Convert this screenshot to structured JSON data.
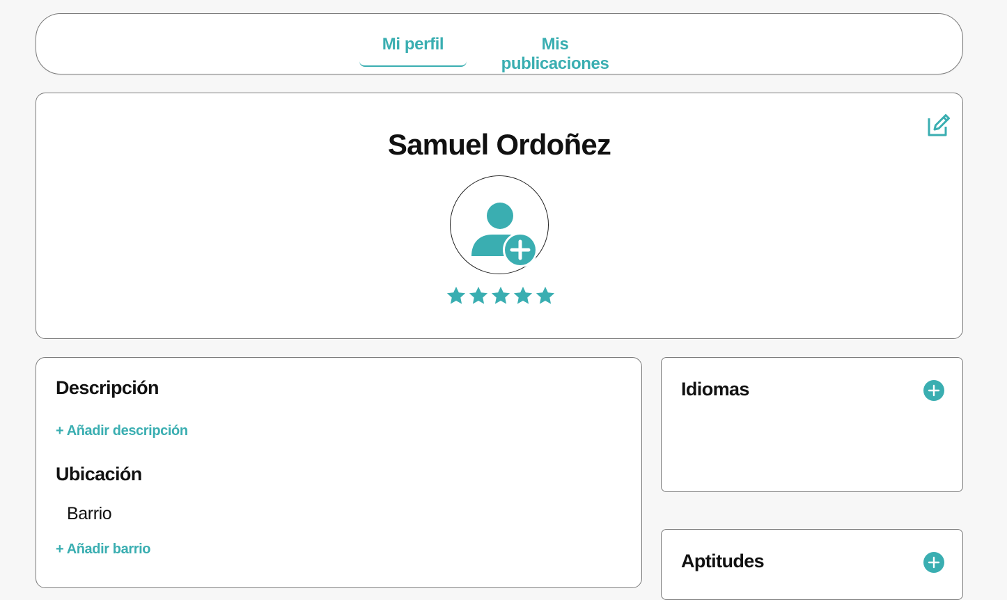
{
  "tabs": [
    {
      "label": "Mi perfil",
      "active": true
    },
    {
      "label": "Mis publicaciones",
      "active": false
    }
  ],
  "profile": {
    "name": "Samuel Ordoñez",
    "rating": 5,
    "rating_max": 5,
    "edit_icon": "edit-icon",
    "avatar_icon": "add-user-icon"
  },
  "details": {
    "description_title": "Descripción",
    "add_description": "+ Añadir descripción",
    "location_title": "Ubicación",
    "neighborhood_label": "Barrio",
    "add_neighborhood": "+ Añadir barrio"
  },
  "languages": {
    "title": "Idiomas",
    "add_icon": "plus-circle-icon"
  },
  "skills": {
    "title": "Aptitudes",
    "add_icon": "plus-circle-icon"
  },
  "colors": {
    "accent": "#3aaeb1",
    "background": "#f7f7f7",
    "card": "#ffffff",
    "text": "#111111"
  }
}
